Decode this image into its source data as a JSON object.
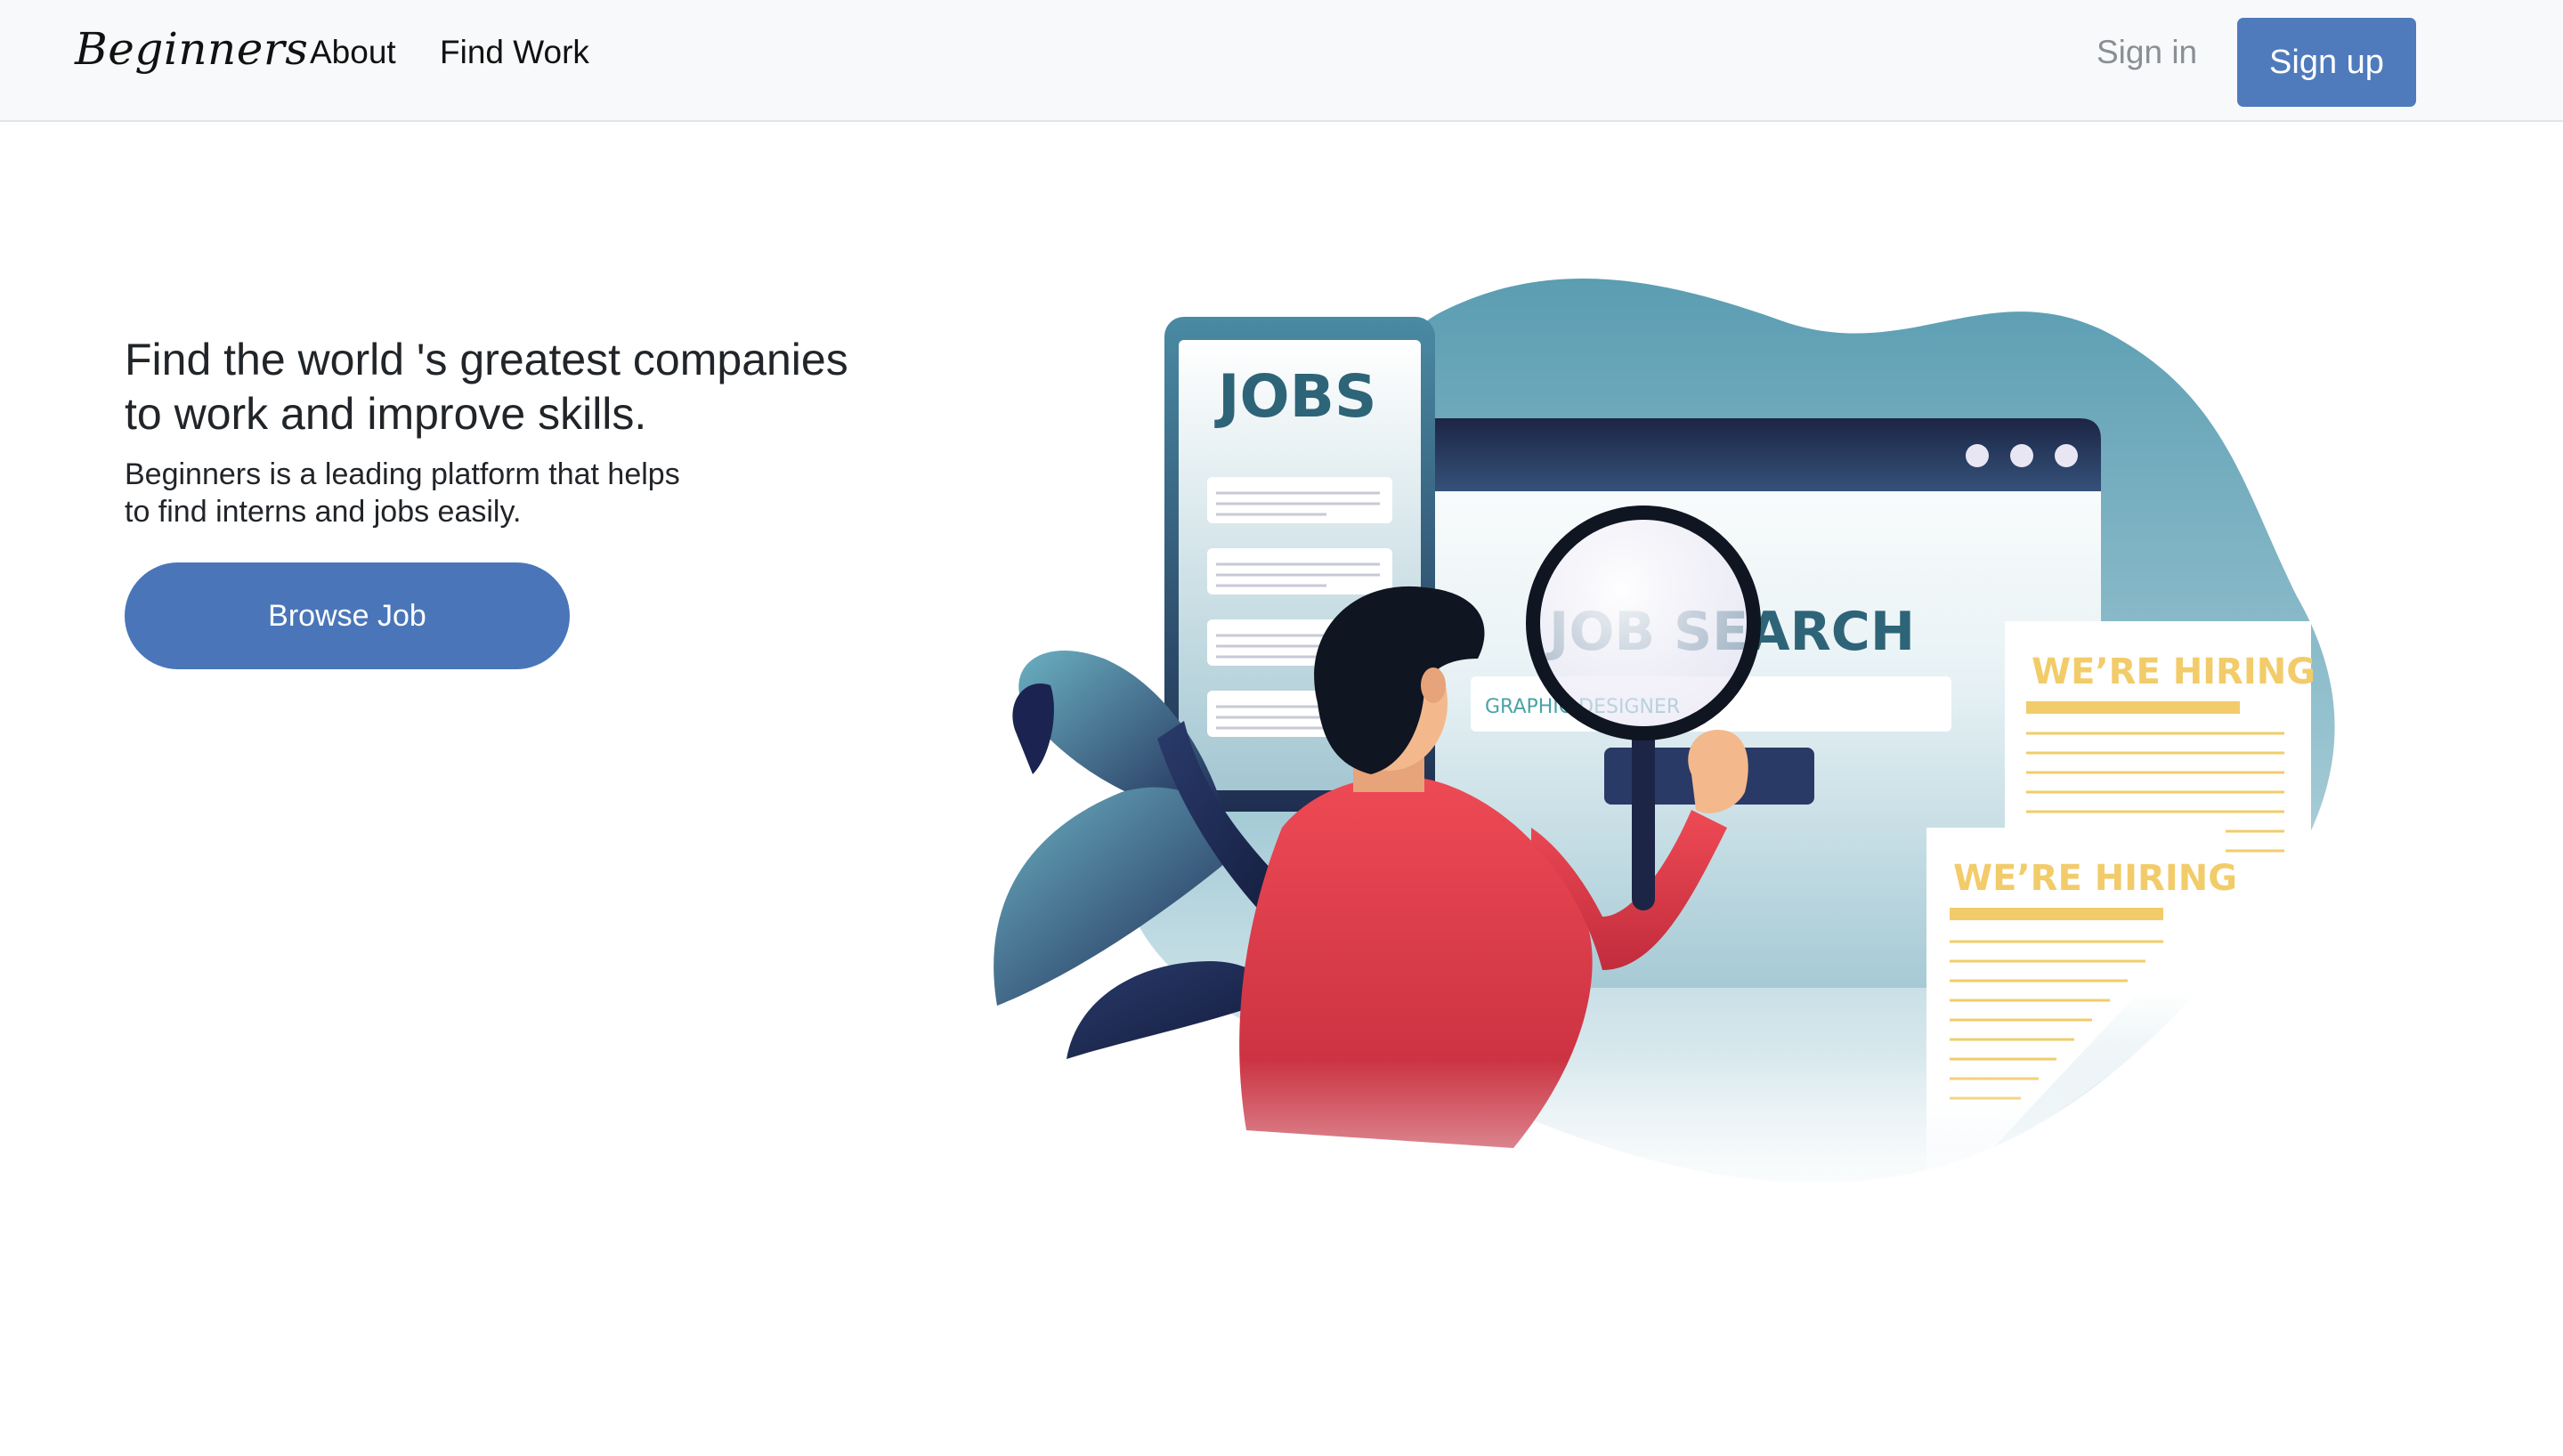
{
  "navbar": {
    "brand": "Beginners",
    "links": [
      {
        "label": "About"
      },
      {
        "label": "Find Work"
      }
    ],
    "sign_in": "Sign in",
    "sign_up": "Sign up"
  },
  "hero": {
    "title_lines": [
      "Find the world 's greatest companies",
      "to work and improve skills."
    ],
    "subtitle_lines": [
      "Beginners is a leading platform that helps",
      "to find interns and jobs easily."
    ],
    "cta": "Browse Job"
  },
  "illustration": {
    "phone_heading": "JOBS",
    "search_heading": "JOB SEARCH",
    "search_query": "GRAPHIC DESIGNER",
    "poster_1_heading": "WE’RE HIRING",
    "poster_2_heading": "WE’RE HIRING",
    "colors": {
      "blob_top": "#5b9db2",
      "blob_bottom": "#eef5f7",
      "navy": "#1f2a4a",
      "teal_text": "#2e6478",
      "shirt": "#e8434f",
      "hiring_yellow": "#f2cc6a",
      "hair": "#101522",
      "skin": "#f3b98c"
    }
  }
}
